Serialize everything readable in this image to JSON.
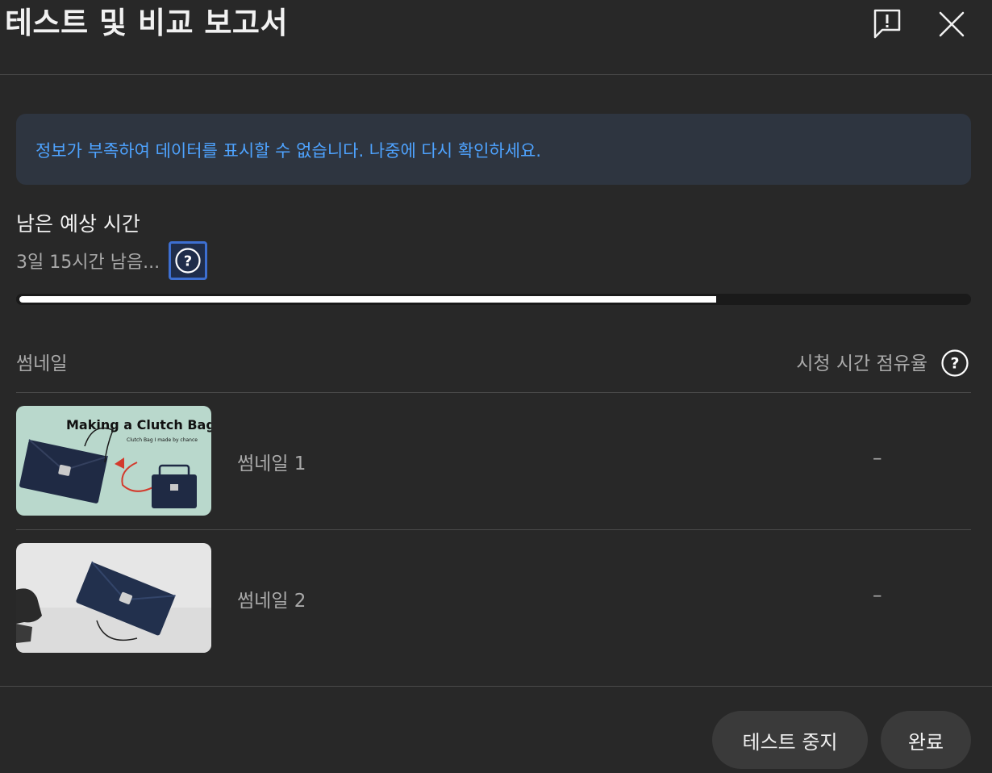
{
  "header": {
    "title": "테스트 및 비교 보고서",
    "feedback_icon": "feedback-exclamation-icon",
    "close_icon": "close-icon"
  },
  "banner": {
    "message": "정보가 부족하여 데이터를 표시할 수 없습니다. 나중에 다시 확인하세요.",
    "color": "#4ea3ff"
  },
  "eta": {
    "title": "남은 예상 시간",
    "value": "3일 15시간 남음...",
    "progress_fraction": 0.735
  },
  "table": {
    "col_thumbnail": "썸네일",
    "col_watch_share": "시청 시간 점유율",
    "rows": [
      {
        "label": "썸네일 1",
        "value": "–",
        "thumb_title": "Making a Clutch Bag",
        "thumb_subtitle": "Clutch Bag I made by chance"
      },
      {
        "label": "썸네일 2",
        "value": "–"
      }
    ]
  },
  "footer": {
    "stop_label": "테스트 중지",
    "done_label": "완료"
  }
}
